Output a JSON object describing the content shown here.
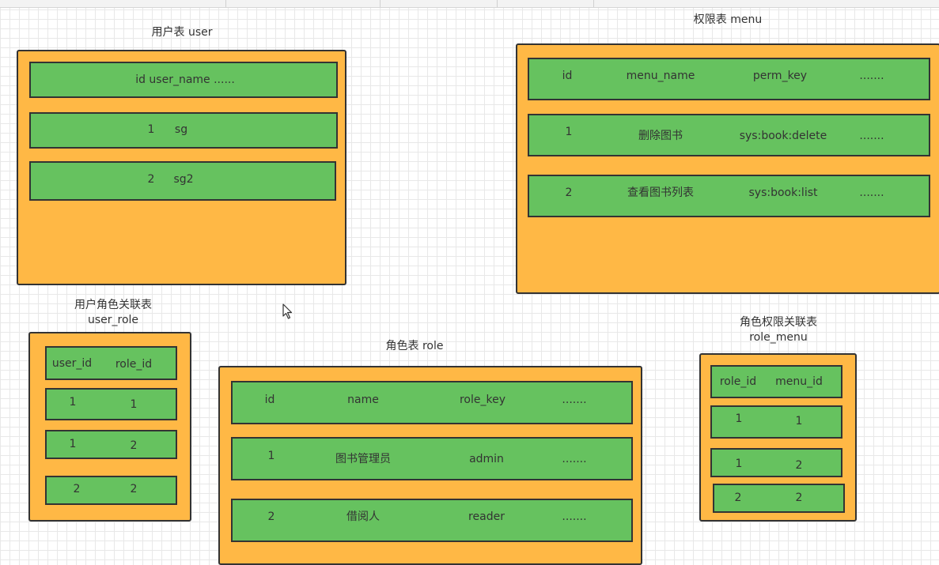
{
  "colors": {
    "table_fill": "#ffb845",
    "row_fill": "#66c25f",
    "border": "#333333",
    "grid": "#e8e8e8"
  },
  "user_table": {
    "title": "用户表  user",
    "rows": [
      [
        "id user_name ......"
      ],
      [
        "1",
        "sg"
      ],
      [
        "2",
        "sg2"
      ]
    ]
  },
  "menu_table": {
    "title": "权限表  menu",
    "rows": [
      [
        "id",
        "menu_name",
        "perm_key",
        "......."
      ],
      [
        "1",
        "删除图书",
        "sys:book:delete",
        "......."
      ],
      [
        "2",
        "查看图书列表",
        "sys:book:list",
        "......."
      ]
    ]
  },
  "user_role_table": {
    "title_line1": "用户角色关联表",
    "title_line2": "user_role",
    "rows": [
      [
        "user_id",
        "role_id"
      ],
      [
        "1",
        "1"
      ],
      [
        "1",
        "2"
      ],
      [
        "2",
        "2"
      ]
    ]
  },
  "role_table": {
    "title": "角色表   role",
    "rows": [
      [
        "id",
        "name",
        "role_key",
        "......."
      ],
      [
        "1",
        "图书管理员",
        "admin",
        "......."
      ],
      [
        "2",
        "借阅人",
        "reader",
        "......."
      ]
    ]
  },
  "role_menu_table": {
    "title_line1": "角色权限关联表",
    "title_line2": "role_menu",
    "rows": [
      [
        "role_id",
        "menu_id"
      ],
      [
        "1",
        "1"
      ],
      [
        "1",
        "2"
      ],
      [
        "2",
        "2"
      ]
    ]
  }
}
